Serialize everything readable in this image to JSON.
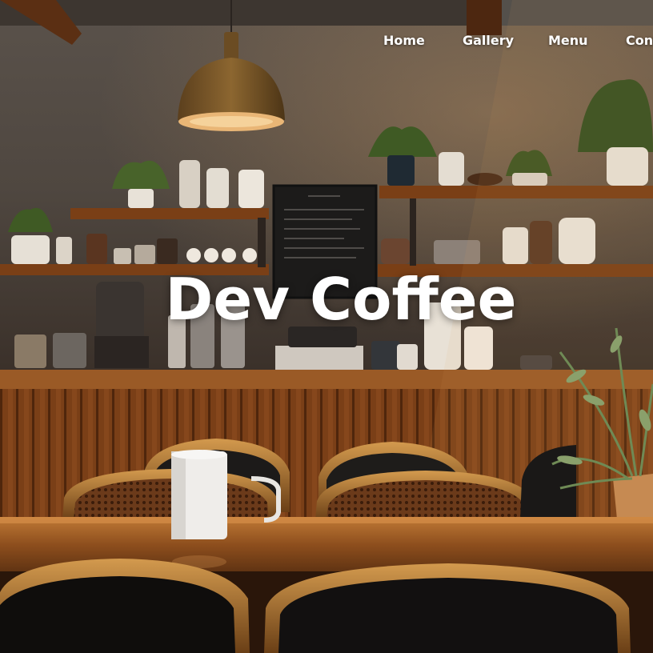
{
  "nav": {
    "items": [
      {
        "label": "Home"
      },
      {
        "label": "Gallery"
      },
      {
        "label": "Menu"
      },
      {
        "label": "Contact"
      }
    ]
  },
  "hero": {
    "title": "Dev Coffee",
    "background": "coffee-shop-interior-photo"
  }
}
